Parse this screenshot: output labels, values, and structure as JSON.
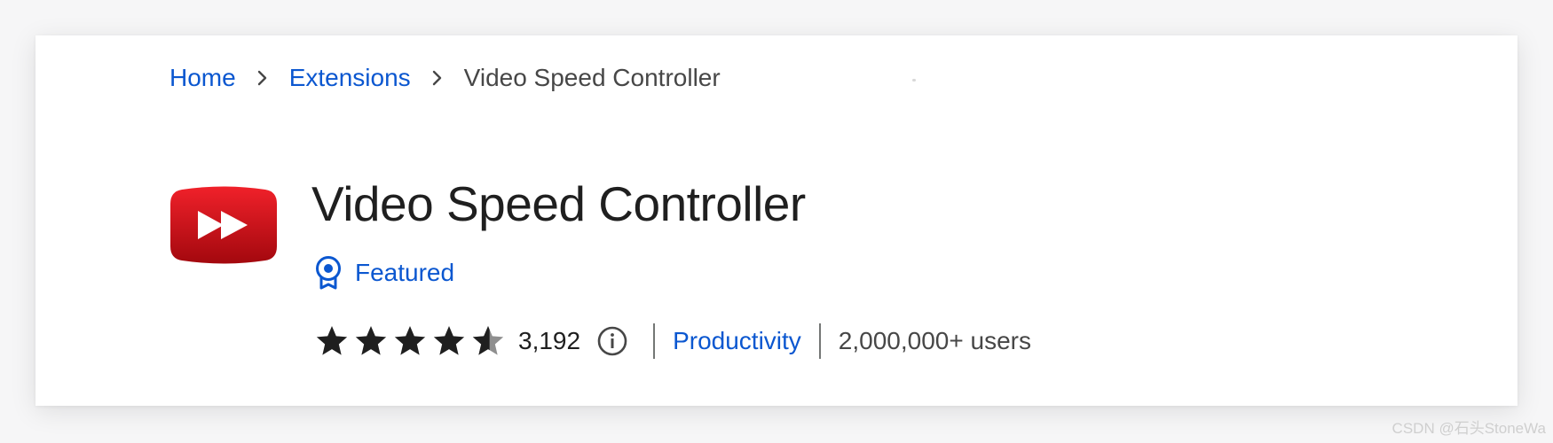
{
  "breadcrumb": {
    "home_label": "Home",
    "extensions_label": "Extensions",
    "current_label": "Video Speed Controller"
  },
  "extension": {
    "name": "Video Speed Controller",
    "icon": "red-fast-forward-icon",
    "featured_label": "Featured",
    "rating": 4.5,
    "rating_count": "3,192",
    "category": "Productivity",
    "users": "2,000,000+ users"
  },
  "watermark": "CSDN @石头StoneWa",
  "colors": {
    "link": "#0b57d0",
    "title": "#1f1f1f",
    "muted": "#474747",
    "icon_red": "#d5141b",
    "star": "#1f1f1f"
  }
}
